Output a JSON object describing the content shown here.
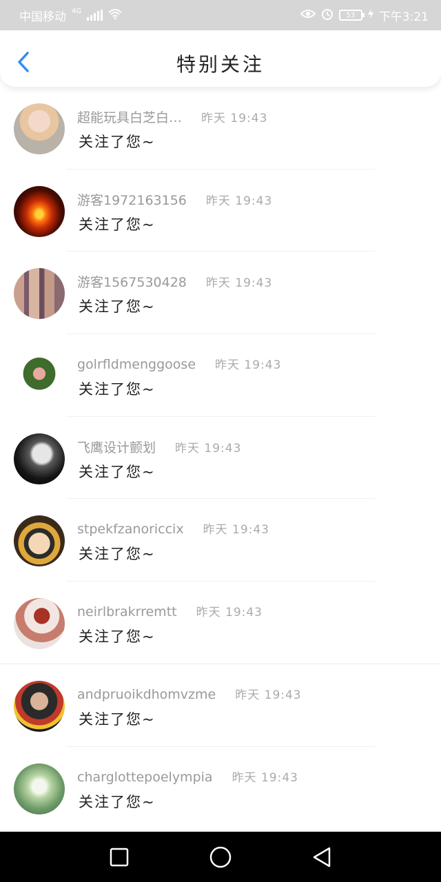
{
  "status_bar": {
    "carrier": "中国移动",
    "network": "4G",
    "battery": "53",
    "time": "下午3:21"
  },
  "header": {
    "title": "特别关注",
    "back_icon": "chevron-left-icon",
    "accent_color": "#2e8ef0"
  },
  "items": [
    {
      "username": "超能玩具白芝白…",
      "time": "昨天 19:43",
      "message": "关注了您~"
    },
    {
      "username": "游客1972163156",
      "time": "昨天 19:43",
      "message": "关注了您~"
    },
    {
      "username": "游客1567530428",
      "time": "昨天 19:43",
      "message": "关注了您~"
    },
    {
      "username": "golrfldmenggoose",
      "time": "昨天 19:43",
      "message": "关注了您~"
    },
    {
      "username": "飞鹰设计颤划",
      "time": "昨天 19:43",
      "message": "关注了您~"
    },
    {
      "username": "stpekfzanoriccix",
      "time": "昨天 19:43",
      "message": "关注了您~"
    },
    {
      "username": "neirlbrakrremtt",
      "time": "昨天 19:43",
      "message": "关注了您~"
    },
    {
      "username": "andpruoikdhomvzme",
      "time": "昨天 19:43",
      "message": "关注了您~"
    },
    {
      "username": "charglottepoelympia",
      "time": "昨天 19:43",
      "message": "关注了您~"
    }
  ],
  "nav": {
    "recent_icon": "square-icon",
    "home_icon": "circle-icon",
    "back_icon": "triangle-back-icon"
  }
}
